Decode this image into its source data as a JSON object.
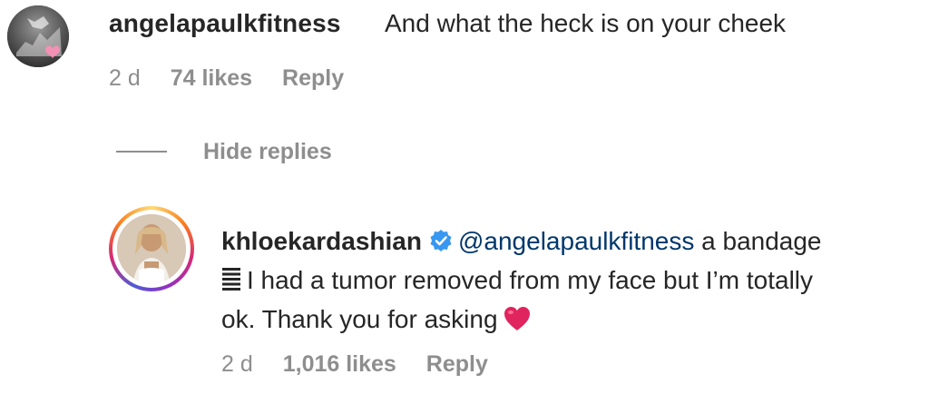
{
  "comment": {
    "username": "angelapaulkfitness",
    "text": "And what the heck is on your cheek",
    "time": "2 d",
    "likes": "74 likes",
    "reply_label": "Reply",
    "avatar_icon": "profile-photo"
  },
  "hide_replies": {
    "label": "Hide replies"
  },
  "reply": {
    "username": "khloekardashian",
    "verified_icon": "verified-badge-icon",
    "mention": "@angelapaulkfitness",
    "text_part1": " a bandage",
    "text_part2": "I had a tumor removed from my face but I’m totally",
    "text_part3": "ok. Thank you for asking",
    "inline_icons": [
      "lines-icon",
      "red-heart-emoji"
    ],
    "time": "2 d",
    "likes": "1,016 likes",
    "reply_label": "Reply",
    "accent_colors": {
      "mention": "#00376b",
      "verified": "#3897f0",
      "heart": "#e0245e",
      "meta": "#8e8e8e"
    }
  }
}
